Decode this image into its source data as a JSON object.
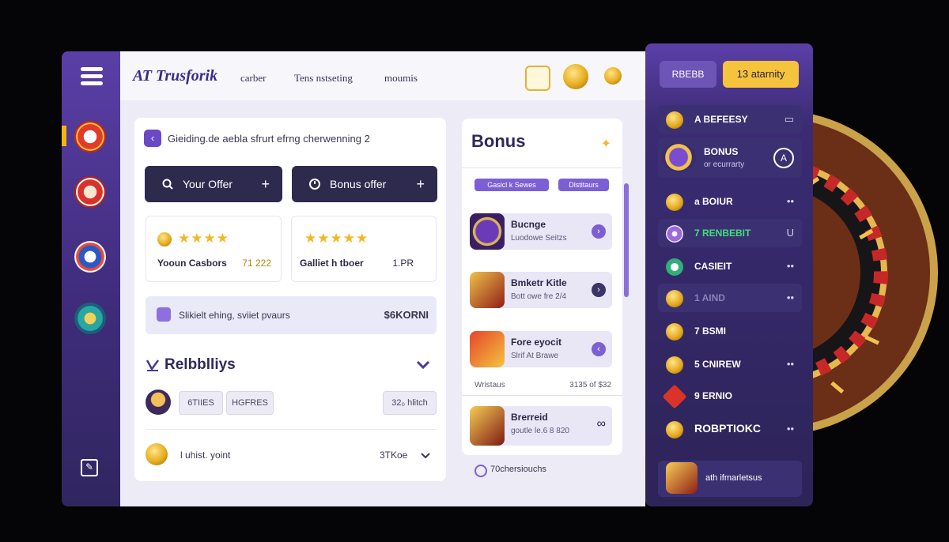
{
  "header": {
    "logo": "ΑΤ Trusforik",
    "nav": [
      "carber",
      "Tens nstseting",
      "moumis"
    ]
  },
  "breadcrumb": {
    "text": "Gieiding.de aebla sfrurt efrng cherwenning 2"
  },
  "offers": {
    "your_offer": "Your Offer",
    "bonus_offer": "Bonus offer",
    "plus": "+"
  },
  "mini_cards": [
    {
      "name": "Yooun Casbors",
      "value": "71 222",
      "rating": "★★★★"
    },
    {
      "name": "Galliet h tboer",
      "value": "1.PR",
      "rating": "★★★★★"
    }
  ],
  "promo_banner": {
    "text": "Slikielt ehing, sviiet pvaurs",
    "code": "$6KORNI"
  },
  "rebuilds": {
    "title": "Relbblliys",
    "chips": [
      "6TIIES",
      "HGFRES"
    ],
    "chip_right": "32₀ hlitch",
    "row_text": "l uhist. yoint",
    "row_value": "3TKoe"
  },
  "bonus": {
    "title": "Bonus",
    "pills": [
      "Gasicl k Sewes",
      "Dlstitaurs"
    ],
    "items": [
      {
        "title": "Bucnge",
        "sub": "Luodowe Seitzs"
      },
      {
        "title": "Bmketr Kitle",
        "sub": "Bott owe fre 2/4"
      },
      {
        "title": "Fore eyocit",
        "sub": "Slrif At Brawe"
      }
    ],
    "summary_left": "Wristaus",
    "summary_right": "3135 of $32",
    "item4": {
      "title": "Brerreid",
      "sub": "goutle le.6 8 820"
    },
    "footer": "70chersiouchs"
  },
  "right_panel": {
    "btn1": "RBEBB",
    "btn2": "13 atarnity",
    "rows": [
      {
        "label": "A BEFEESY"
      },
      {
        "label": "BONUS",
        "sub": "or ecurrarty"
      },
      {
        "label": "a BOIUR"
      },
      {
        "label": "7 RENBEBIT"
      },
      {
        "label": "CASIEIT"
      },
      {
        "label": "1 AIND"
      },
      {
        "label": "7 BSMI"
      },
      {
        "label": "5 CNIREW"
      },
      {
        "label": "9 ERNIO"
      },
      {
        "label": "ROBPTIOKC"
      }
    ],
    "footer": "ath ifmarletsus"
  },
  "colors": {
    "accent_purple": "#6b49c6",
    "dark_button": "#2d2a4e",
    "gold": "#f6c33c",
    "highlight_green": "#3fe07a"
  }
}
